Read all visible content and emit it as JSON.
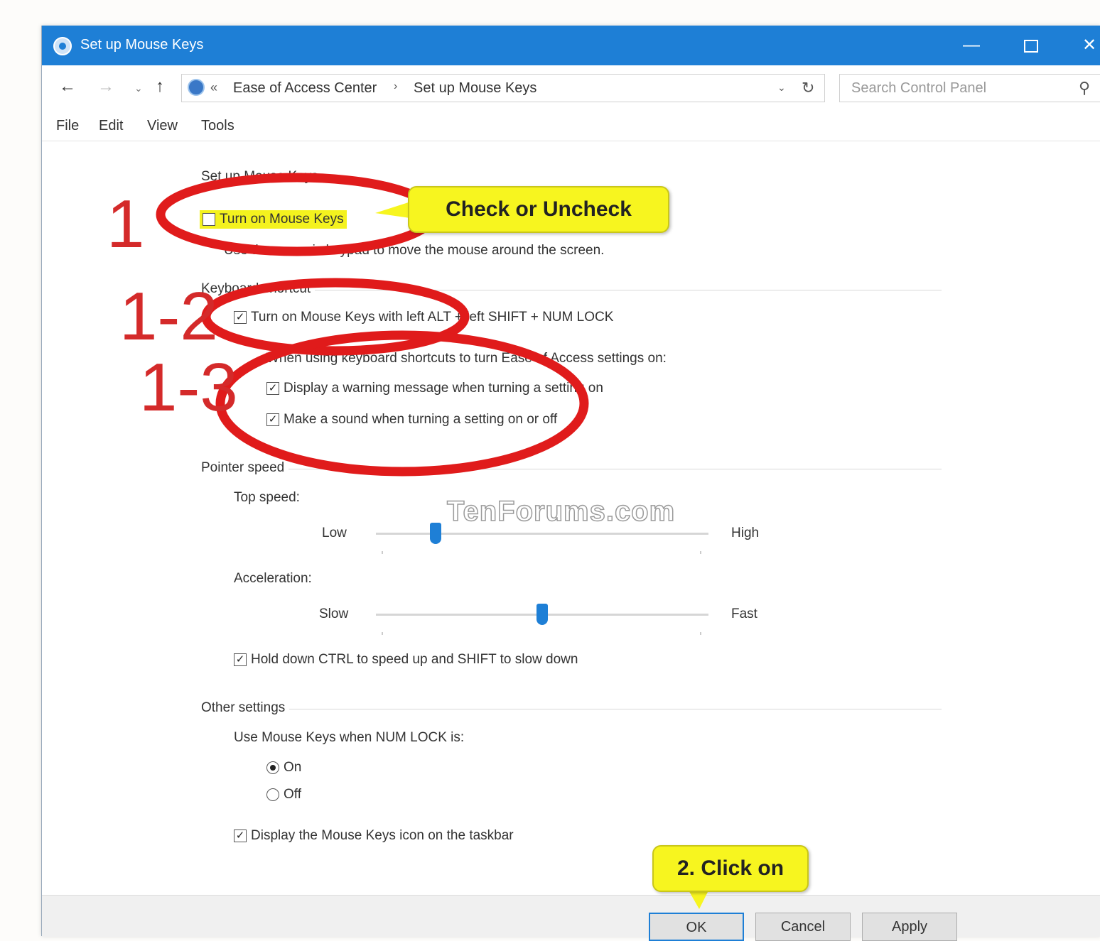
{
  "window": {
    "title": "Set up Mouse Keys",
    "minimize_glyph": "—",
    "close_glyph": "✕"
  },
  "address": {
    "back_glyph": "←",
    "forward_glyph": "→",
    "dropdown_glyph": "⌄",
    "up_glyph": "↑",
    "separator0": "«",
    "crumb1": "Ease of Access Center",
    "separator1": "›",
    "crumb2": "Set up Mouse Keys",
    "history_glyph": "⌄",
    "refresh_glyph": "↻",
    "search_placeholder": "Search Control Panel",
    "search_glyph": "⚲"
  },
  "menu": {
    "file": "File",
    "edit": "Edit",
    "view": "View",
    "tools": "Tools"
  },
  "main": {
    "top_heading": "Set up Mouse Keys",
    "turn_on_label": "Turn on Mouse Keys",
    "turn_on_checked": false,
    "turn_on_description": "Use the numeric keypad to move the mouse around the screen.",
    "keyboard_shortcut_heading": "Keyboard shortcut",
    "shortcut_label": "Turn on Mouse Keys with left ALT + left SHIFT + NUM LOCK",
    "shortcut_checked": true,
    "when_using_label": "When using keyboard shortcuts to turn Ease of Access settings on:",
    "warning_label": "Display a warning message when turning a setting on",
    "warning_checked": true,
    "sound_label": "Make a sound when turning a setting on or off",
    "sound_checked": true,
    "pointer_speed_heading": "Pointer speed",
    "top_speed_label": "Top speed:",
    "top_speed_low": "Low",
    "top_speed_high": "High",
    "top_speed_level": 0.18,
    "acceleration_label": "Acceleration:",
    "acceleration_slow": "Slow",
    "acceleration_fast": "Fast",
    "acceleration_level": 0.5,
    "hold_ctrl_label": "Hold down CTRL to speed up and SHIFT to slow down",
    "hold_ctrl_checked": true,
    "other_settings_heading": "Other settings",
    "num_lock_label": "Use Mouse Keys when NUM LOCK is:",
    "radio_on_label": "On",
    "radio_off_label": "Off",
    "radio_selected": "On",
    "taskbar_icon_label": "Display the Mouse Keys icon on the taskbar",
    "taskbar_icon_checked": true
  },
  "footer": {
    "ok_label": "OK",
    "cancel_label": "Cancel",
    "apply_label": "Apply"
  },
  "annotations": {
    "step1": "1",
    "step1_2": "1-2",
    "step1_3": "1-3",
    "callout_check": "Check or Uncheck",
    "callout_click": "2. Click on",
    "watermark": "TenForums.com",
    "circle_color": "#e01b1b",
    "callout_color": "#f7f51f"
  },
  "check_glyph": "✓"
}
